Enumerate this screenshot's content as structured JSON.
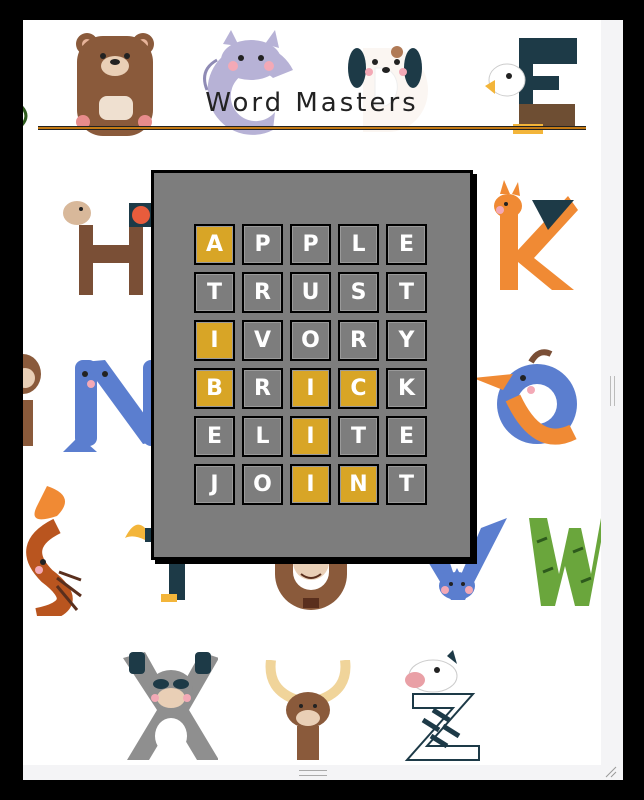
{
  "title": "Word Masters",
  "board": {
    "rows": [
      [
        {
          "l": "A",
          "s": "hit"
        },
        {
          "l": "P",
          "s": "miss"
        },
        {
          "l": "P",
          "s": "miss"
        },
        {
          "l": "L",
          "s": "miss"
        },
        {
          "l": "E",
          "s": "miss"
        }
      ],
      [
        {
          "l": "T",
          "s": "miss"
        },
        {
          "l": "R",
          "s": "miss"
        },
        {
          "l": "U",
          "s": "miss"
        },
        {
          "l": "S",
          "s": "miss"
        },
        {
          "l": "T",
          "s": "miss"
        }
      ],
      [
        {
          "l": "I",
          "s": "hit"
        },
        {
          "l": "V",
          "s": "miss"
        },
        {
          "l": "O",
          "s": "miss"
        },
        {
          "l": "R",
          "s": "miss"
        },
        {
          "l": "Y",
          "s": "miss"
        }
      ],
      [
        {
          "l": "B",
          "s": "hit"
        },
        {
          "l": "R",
          "s": "miss"
        },
        {
          "l": "I",
          "s": "hit"
        },
        {
          "l": "C",
          "s": "hit"
        },
        {
          "l": "K",
          "s": "miss"
        }
      ],
      [
        {
          "l": "E",
          "s": "miss"
        },
        {
          "l": "L",
          "s": "miss"
        },
        {
          "l": "I",
          "s": "hit"
        },
        {
          "l": "T",
          "s": "miss"
        },
        {
          "l": "E",
          "s": "miss"
        }
      ],
      [
        {
          "l": "J",
          "s": "miss"
        },
        {
          "l": "O",
          "s": "miss"
        },
        {
          "l": "I",
          "s": "hit"
        },
        {
          "l": "N",
          "s": "hit"
        },
        {
          "l": "T",
          "s": "miss"
        }
      ]
    ]
  },
  "colors": {
    "hit": "#d8a526",
    "miss": "#7d7d7d",
    "board": "#7d7d7d",
    "rule": "#c47a14"
  },
  "background_letters": [
    "B",
    "C",
    "D",
    "E",
    "H",
    "K",
    "N",
    "Q",
    "S",
    "W",
    "X",
    "Y",
    "Z"
  ]
}
